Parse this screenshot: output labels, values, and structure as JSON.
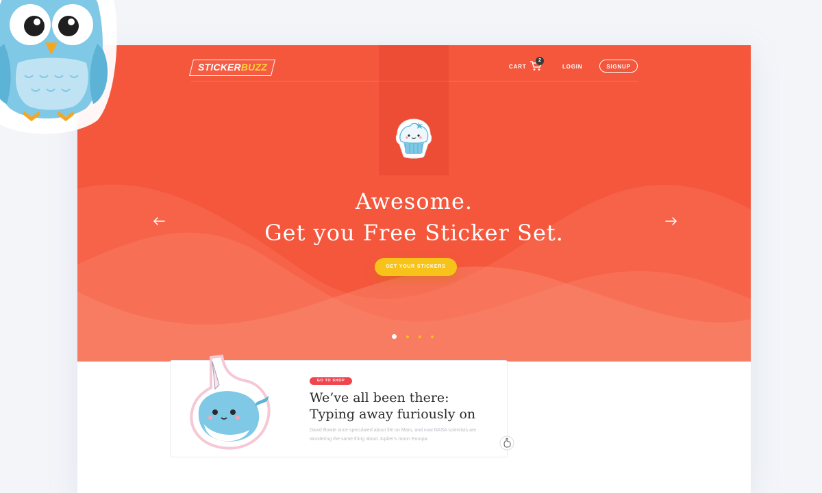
{
  "brand": {
    "name_part1": "STICKER",
    "name_part2": "BUZZ",
    "accent_color": "#f5573d",
    "cta_color": "#f7c21a"
  },
  "nav": {
    "cart_label": "CART",
    "cart_count": "2",
    "login_label": "LOGIN",
    "signup_label": "SIGNUP"
  },
  "hero": {
    "headline_line1": "Awesome.",
    "headline_line2": "Get you Free Sticker Set.",
    "cta_label": "GET YOUR STICKERS",
    "slide_count": 4,
    "active_slide": 1,
    "prev_icon": "arrow-left-icon",
    "next_icon": "arrow-right-icon"
  },
  "feature": {
    "badge": "GO TO SHOP",
    "title_line1": "We’ve all been there:",
    "title_line2": "Typing away furiously on",
    "description": "David Bowie once speculated about life on Mars, and now NASA scientists are wondering the same thing about Jupiter's moon Europa."
  },
  "icons": {
    "cart": "cart-icon",
    "cupcake": "cupcake-sticker",
    "narwhal": "narwhal-sticker",
    "owl": "owl-sticker"
  }
}
